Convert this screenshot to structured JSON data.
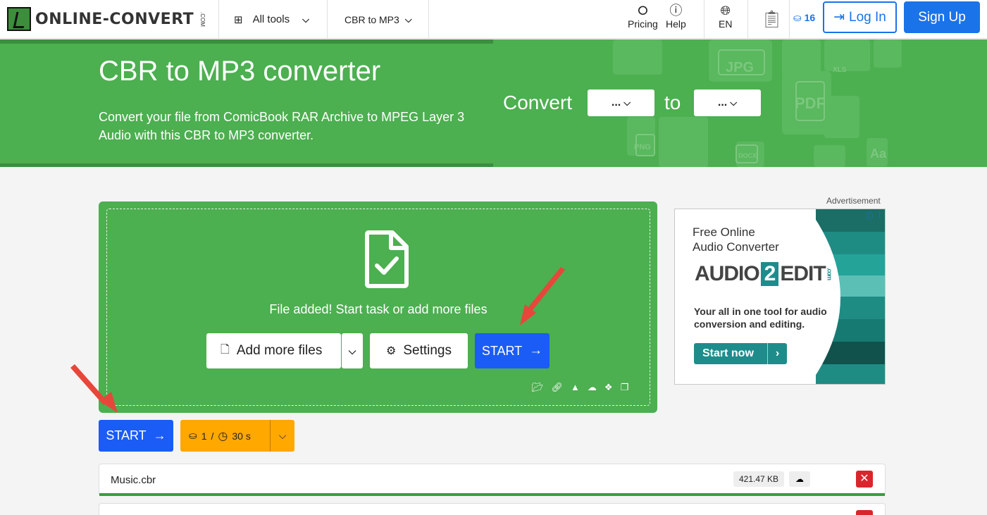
{
  "nav": {
    "logo_text": "ONLINE-CONVERT",
    "logo_suffix": ".COM",
    "all_tools": "All tools",
    "converter_menu": "CBR to MP3",
    "pricing": "Pricing",
    "help": "Help",
    "language": "EN",
    "credits": "16",
    "login": "Log In",
    "signup": "Sign Up"
  },
  "hero": {
    "title": "CBR to MP3 converter",
    "description": "Convert your file from ComicBook RAR Archive to MPEG Layer 3 Audio with this CBR to MP3 converter.",
    "convert_label": "Convert",
    "to_label": "to",
    "from_select": "...",
    "to_select": "..."
  },
  "dropzone": {
    "status": "File added! Start task or add more files",
    "add_more": "Add more files",
    "settings": "Settings",
    "start": "START"
  },
  "start_row": {
    "start": "START",
    "credits": "1",
    "separator": "/",
    "time": "30 s"
  },
  "files": [
    {
      "name": "Music.cbr",
      "size": "421.47 KB",
      "progress": 1.0
    }
  ],
  "ad": {
    "label": "Advertisement",
    "headline_1": "Free Online",
    "headline_2": "Audio Converter",
    "brand_a": "AUDIO",
    "brand_2": "2",
    "brand_b": "EDIT",
    "brand_com": ".com",
    "description": "Your all in one tool for audio conversion and editing.",
    "cta": "Start now"
  },
  "colors": {
    "brand_green": "#4caf50",
    "primary_blue": "#1a5cf5",
    "accent_orange": "#ffa800",
    "danger_red": "#d9262c",
    "arrow_red": "#e8463a"
  }
}
